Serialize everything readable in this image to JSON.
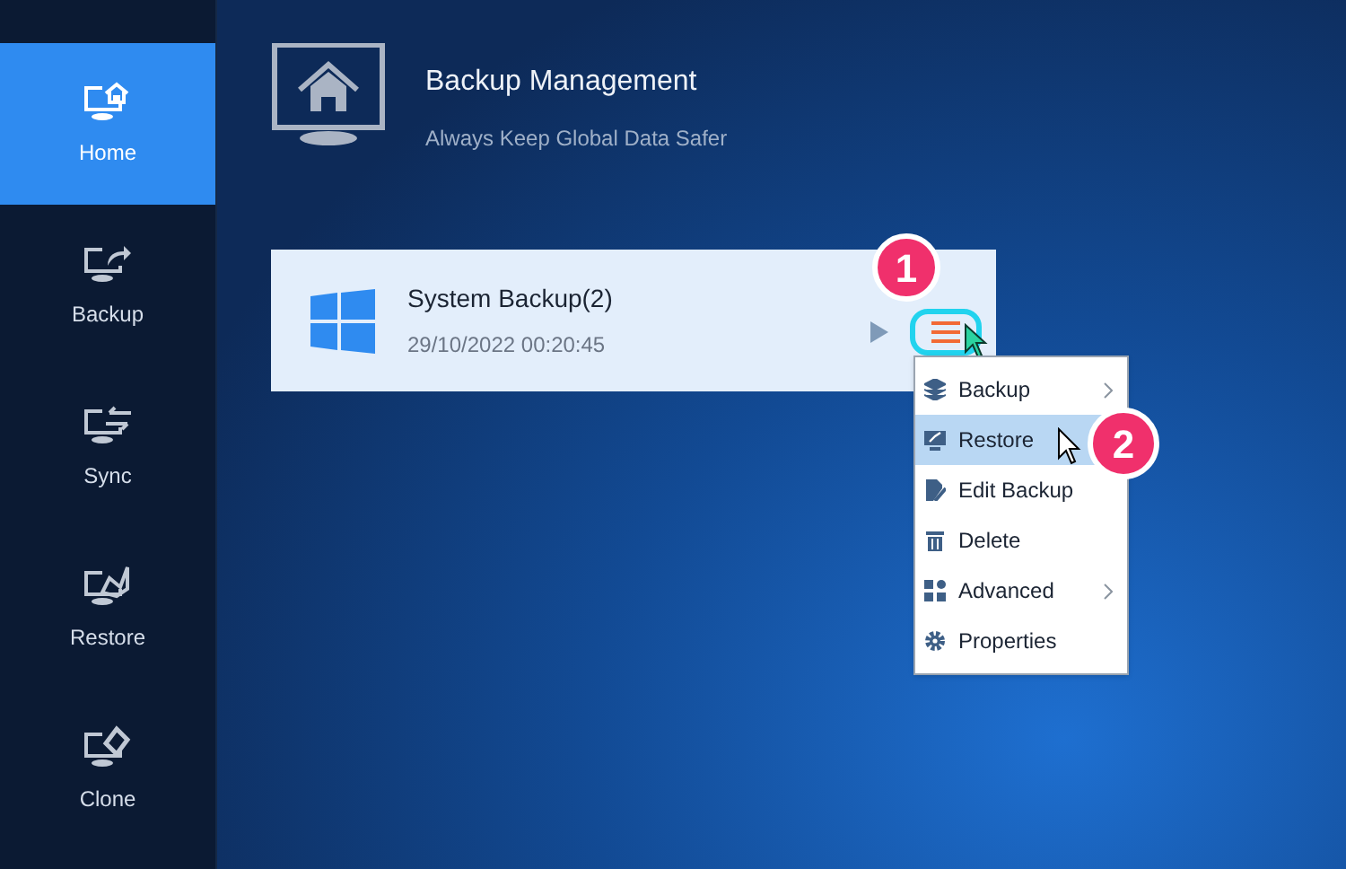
{
  "sidebar": {
    "items": [
      {
        "label": "Home",
        "selected": true
      },
      {
        "label": "Backup",
        "selected": false
      },
      {
        "label": "Sync",
        "selected": false
      },
      {
        "label": "Restore",
        "selected": false
      },
      {
        "label": "Clone",
        "selected": false
      }
    ]
  },
  "header": {
    "title": "Backup Management",
    "subtitle": "Always Keep Global Data Safer"
  },
  "backup_card": {
    "name": "System Backup(2)",
    "time": "29/10/2022 00:20:45"
  },
  "context_menu": {
    "items": [
      {
        "label": "Backup",
        "has_submenu": true,
        "selected": false
      },
      {
        "label": "Restore",
        "has_submenu": false,
        "selected": true
      },
      {
        "label": "Edit Backup",
        "has_submenu": false,
        "selected": false
      },
      {
        "label": "Delete",
        "has_submenu": false,
        "selected": false
      },
      {
        "label": "Advanced",
        "has_submenu": true,
        "selected": false
      },
      {
        "label": "Properties",
        "has_submenu": false,
        "selected": false
      }
    ]
  },
  "callouts": [
    "1",
    "2"
  ]
}
